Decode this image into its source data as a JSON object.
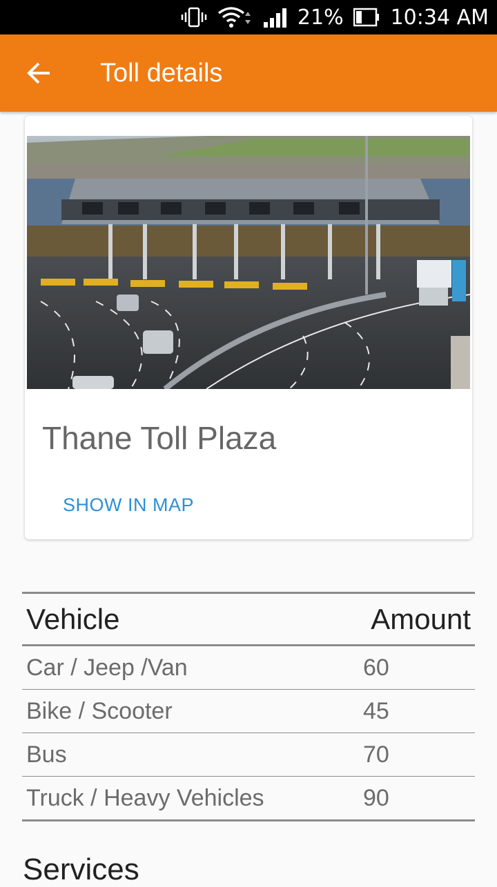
{
  "status_bar": {
    "battery": "21%",
    "time": "10:34 AM",
    "icons": [
      "vibrate-icon",
      "wifi-icon",
      "signal-icon",
      "battery-icon"
    ]
  },
  "app_bar": {
    "title": "Toll details",
    "back_icon": "arrow-back-icon",
    "color": "#f07c14"
  },
  "card": {
    "title": "Thane Toll Plaza",
    "map_button": "SHOW IN MAP",
    "map_button_color": "#2d8fd6"
  },
  "table": {
    "headers": [
      "Vehicle",
      "Amount"
    ],
    "rows": [
      {
        "vehicle": "Car / Jeep /Van",
        "amount": "60"
      },
      {
        "vehicle": "Bike / Scooter",
        "amount": "45"
      },
      {
        "vehicle": "Bus",
        "amount": "70"
      },
      {
        "vehicle": "Truck / Heavy Vehicles",
        "amount": "90"
      }
    ]
  },
  "section": {
    "services_title": "Services"
  }
}
